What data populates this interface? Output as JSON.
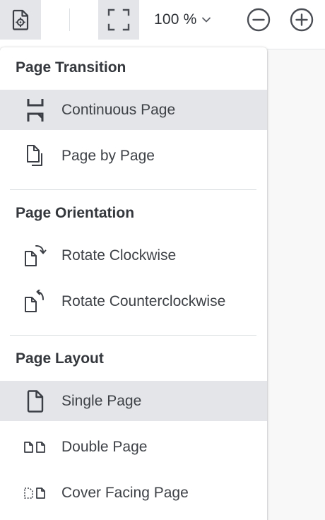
{
  "toolbar": {
    "zoom_value": "100 %",
    "icons": {
      "settings": "page-settings-icon",
      "fullscreen": "fullscreen-icon",
      "zoom_chevron": "chevron-down-icon",
      "zoom_out": "zoom-out-icon",
      "zoom_in": "zoom-in-icon"
    }
  },
  "menu": {
    "sections": [
      {
        "title": "Page Transition",
        "items": [
          {
            "label": "Continuous Page",
            "icon": "continuous-page-icon",
            "selected": true
          },
          {
            "label": "Page by Page",
            "icon": "page-by-page-icon",
            "selected": false
          }
        ]
      },
      {
        "title": "Page Orientation",
        "items": [
          {
            "label": "Rotate Clockwise",
            "icon": "rotate-clockwise-icon",
            "selected": false
          },
          {
            "label": "Rotate Counterclockwise",
            "icon": "rotate-counterclockwise-icon",
            "selected": false
          }
        ]
      },
      {
        "title": "Page Layout",
        "items": [
          {
            "label": "Single Page",
            "icon": "single-page-icon",
            "selected": true
          },
          {
            "label": "Double Page",
            "icon": "double-page-icon",
            "selected": false
          },
          {
            "label": "Cover Facing Page",
            "icon": "cover-facing-page-icon",
            "selected": false
          }
        ]
      }
    ]
  },
  "colors": {
    "selected_bg": "#e3e5e8",
    "icon": "#3b3f45",
    "text": "#3e4247",
    "divider": "#dcdfe2"
  }
}
